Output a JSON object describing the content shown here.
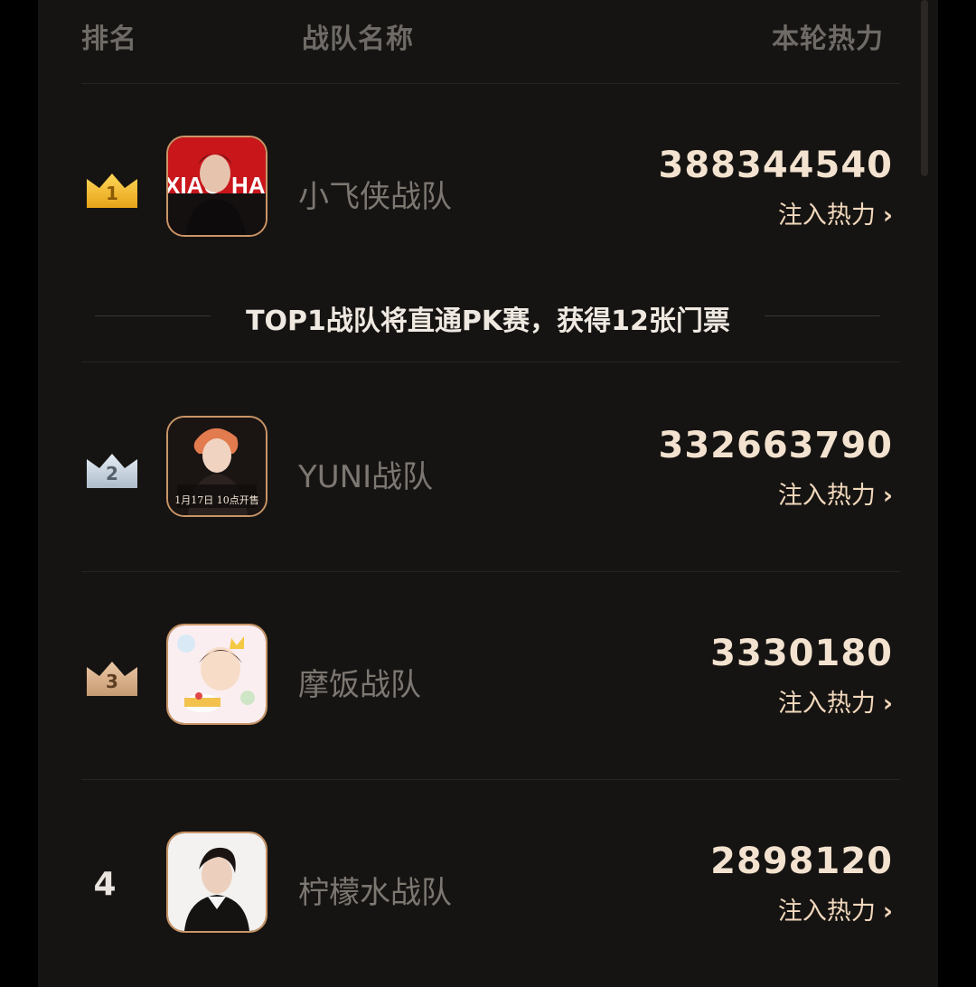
{
  "header": {
    "rank_label": "排名",
    "name_label": "战队名称",
    "heat_label": "本轮热力"
  },
  "banner": {
    "text": "TOP1战队将直通PK赛，获得12张门票"
  },
  "rows": [
    {
      "rank": "1",
      "crown": "gold",
      "name": "小飞侠战队",
      "heat": "388344540",
      "action": "注入热力",
      "avatar_text": "XIAO ZHAN"
    },
    {
      "rank": "2",
      "crown": "silver",
      "name": "YUNI战队",
      "heat": "332663790",
      "action": "注入热力",
      "avatar_text": "1月17日 10点开售"
    },
    {
      "rank": "3",
      "crown": "bronze",
      "name": "摩饭战队",
      "heat": "3330180",
      "action": "注入热力"
    },
    {
      "rank": "4",
      "crown": "none",
      "name": "柠檬水战队",
      "heat": "2898120",
      "action": "注入热力"
    }
  ],
  "icons": {
    "chevron": "chevron-right-icon",
    "crown": "crown-icon"
  },
  "colors": {
    "background": "#161412",
    "heat_value": "#f2e2cf",
    "action_text": "#f1d8bc",
    "avatar_border": "#c99567",
    "gold": "#f3c43f",
    "silver": "#c9d6e3",
    "bronze": "#d4aa84"
  }
}
